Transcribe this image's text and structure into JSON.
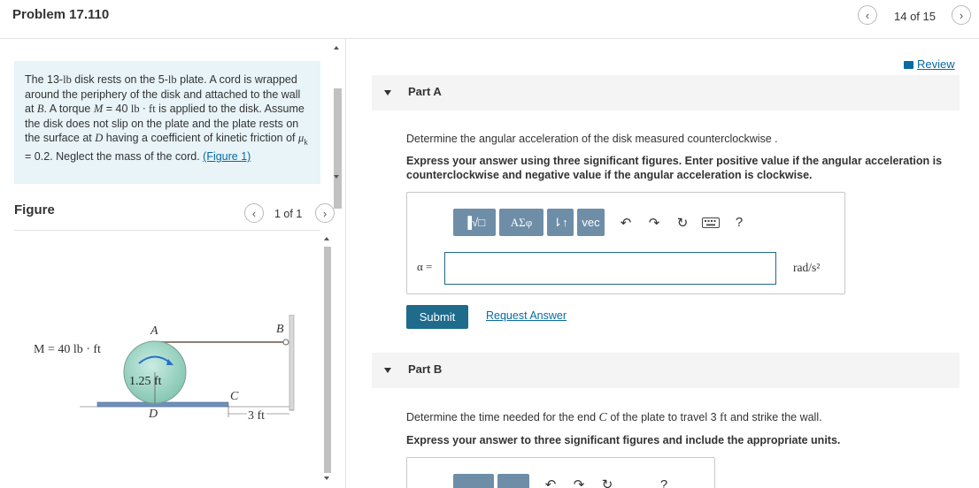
{
  "header": {
    "title": "Problem 17.110",
    "page_count": "14 of 15"
  },
  "problem": {
    "text_1": "The 13-",
    "unit_lb": "lb",
    "text_2": " disk rests on the 5-",
    "text_3": " plate. A cord is wrapped around the periphery of the disk and attached to the wall at ",
    "point_b": "B",
    "text_4": ". A torque ",
    "sym_m": "M",
    "text_5": " = 40 ",
    "unit_lbft": "lb · ft",
    "text_6": " is applied to the disk. Assume the disk does not slip on the plate and the plate rests on the surface at ",
    "point_d": "D",
    "text_7": " having a coefficient of kinetic friction of ",
    "sym_mu": "μ",
    "sub_k": "k",
    "text_8": " = 0.2. Neglect the mass of the cord. ",
    "figure_link": "(Figure 1)"
  },
  "figure": {
    "heading": "Figure",
    "count": "1 of 1",
    "torque_label": "M = 40 lb · ft",
    "label_a": "A",
    "label_b": "B",
    "label_c": "C",
    "label_d": "D",
    "radius_label": "1.25 ft",
    "length_label": "3 ft"
  },
  "review": {
    "label": "Review"
  },
  "part_a": {
    "label": "Part A",
    "question": "Determine the angular acceleration of the disk measured counterclockwise .",
    "instruction": "Express your answer using three significant figures. Enter positive value if the angular acceleration is counterclockwise and negative value if the angular acceleration is clockwise.",
    "toolbar": {
      "templates": "▐√□",
      "greek": "ΑΣφ",
      "arrows": "⇂↑",
      "vec": "vec",
      "help": "?"
    },
    "variable": "α =",
    "input_value": "",
    "units": "rad/s²",
    "submit": "Submit",
    "request": "Request Answer"
  },
  "part_b": {
    "label": "Part B",
    "question_1": "Determine the time needed for the end ",
    "point_c": "C",
    "question_2": " of the plate to travel 3 ",
    "unit_ft": "ft",
    "question_3": " and strike the wall.",
    "instruction": "Express your answer to three significant figures and include the appropriate units."
  },
  "colors": {
    "accent": "#1e6b8c",
    "link": "#0a6aa1",
    "toolbar": "#6e8ea8",
    "problem_bg": "#e8f4f8",
    "disk": "#9fd4c4"
  }
}
